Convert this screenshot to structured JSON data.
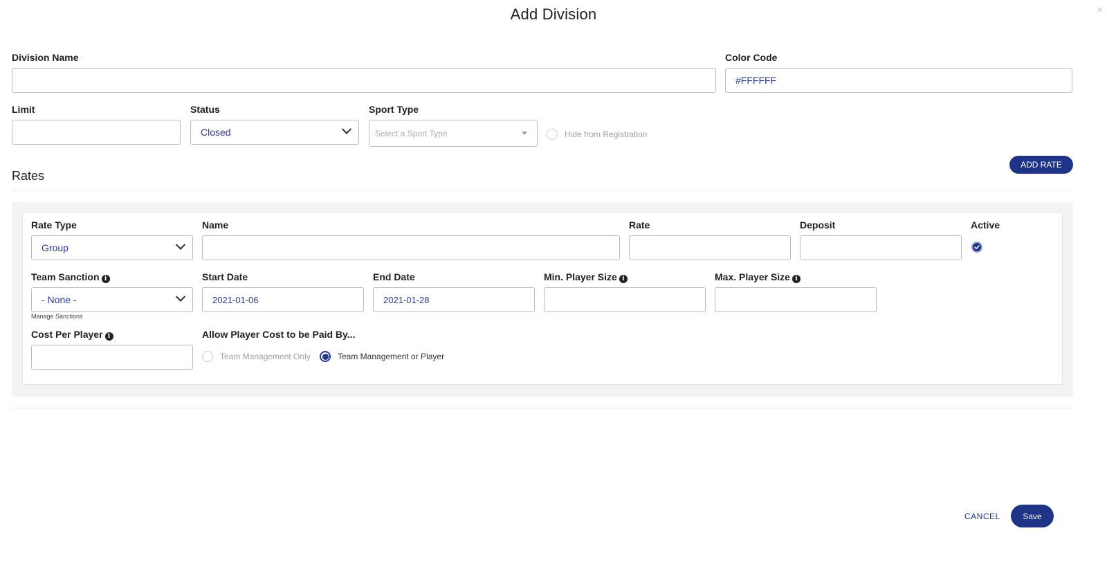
{
  "dialog": {
    "title": "Add Division",
    "close": "×"
  },
  "division": {
    "name_label": "Division Name",
    "name_value": "",
    "color_label": "Color Code",
    "color_value": "#FFFFFF",
    "limit_label": "Limit",
    "limit_value": "",
    "status_label": "Status",
    "status_value": "Closed",
    "sport_label": "Sport Type",
    "sport_placeholder": "Select a Sport Type",
    "hide_label": "Hide from Registration"
  },
  "rates": {
    "title": "Rates",
    "add_button": "ADD RATE",
    "rate_type_label": "Rate Type",
    "rate_type_value": "Group",
    "name_label": "Name",
    "rate_label": "Rate",
    "deposit_label": "Deposit",
    "active_label": "Active",
    "team_sanction_label": "Team Sanction",
    "team_sanction_value": "- None -",
    "manage_sanctions": "Manage Sanctions",
    "start_date_label": "Start Date",
    "start_date_value": "2021-01-06",
    "end_date_label": "End Date",
    "end_date_value": "2021-01-28",
    "min_player_label": "Min. Player Size",
    "max_player_label": "Max. Player Size",
    "cost_per_player_label": "Cost Per Player",
    "allow_label": "Allow Player Cost to be Paid By...",
    "option_team_only": "Team Management Only",
    "option_team_or_player": "Team Management or Player",
    "info_glyph": "i"
  },
  "footer": {
    "cancel": "CANCEL",
    "save": "Save"
  }
}
